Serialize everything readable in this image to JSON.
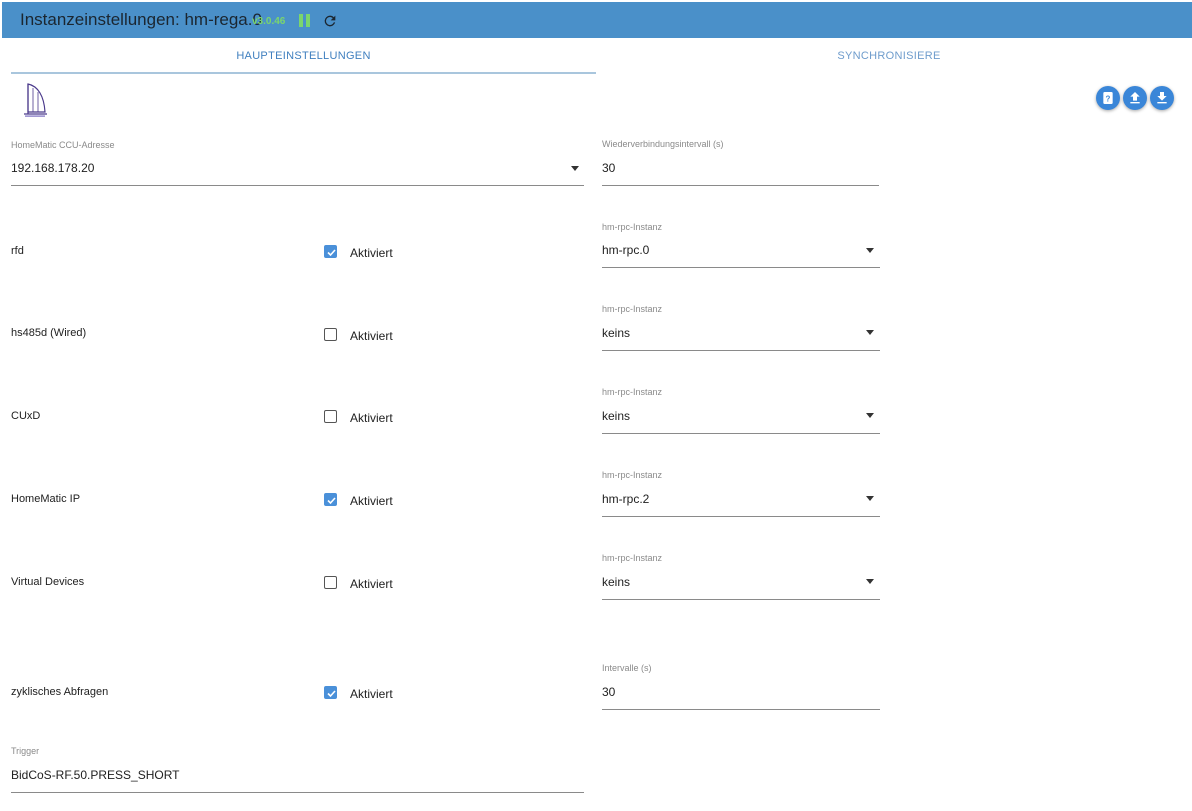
{
  "header": {
    "title": "Instanzeinstellungen: hm-rega.0",
    "version": "v3.0.46",
    "colors": {
      "bar": "#4a90c9",
      "version": "#7bd66c"
    }
  },
  "tabs": [
    {
      "label": "HAUPTEINSTELLUNGEN",
      "active": true
    },
    {
      "label": "SYNCHRONISIERE",
      "active": false
    }
  ],
  "toolbar": {
    "icons": [
      "help-icon",
      "upload-icon",
      "download-icon"
    ]
  },
  "ccu": {
    "label": "HomeMatic CCU-Adresse",
    "value": "192.168.178.20"
  },
  "reconnect": {
    "label": "Wiederverbindungsintervall (s)",
    "value": "30"
  },
  "rows": [
    {
      "label": "rfd",
      "checked": true,
      "check_label": "Aktiviert",
      "instance_label": "hm-rpc-Instanz",
      "instance_value": "hm-rpc.0"
    },
    {
      "label": "hs485d (Wired)",
      "checked": false,
      "check_label": "Aktiviert",
      "instance_label": "hm-rpc-Instanz",
      "instance_value": "keins"
    },
    {
      "label": "CUxD",
      "checked": false,
      "check_label": "Aktiviert",
      "instance_label": "hm-rpc-Instanz",
      "instance_value": "keins"
    },
    {
      "label": "HomeMatic IP",
      "checked": true,
      "check_label": "Aktiviert",
      "instance_label": "hm-rpc-Instanz",
      "instance_value": "hm-rpc.2"
    },
    {
      "label": "Virtual Devices",
      "checked": false,
      "check_label": "Aktiviert",
      "instance_label": "hm-rpc-Instanz",
      "instance_value": "keins"
    }
  ],
  "polling": {
    "label": "zyklisches Abfragen",
    "checked": true,
    "check_label": "Aktiviert",
    "interval_label": "Intervalle (s)",
    "interval_value": "30"
  },
  "trigger": {
    "label": "Trigger",
    "value": "BidCoS-RF.50.PRESS_SHORT"
  }
}
